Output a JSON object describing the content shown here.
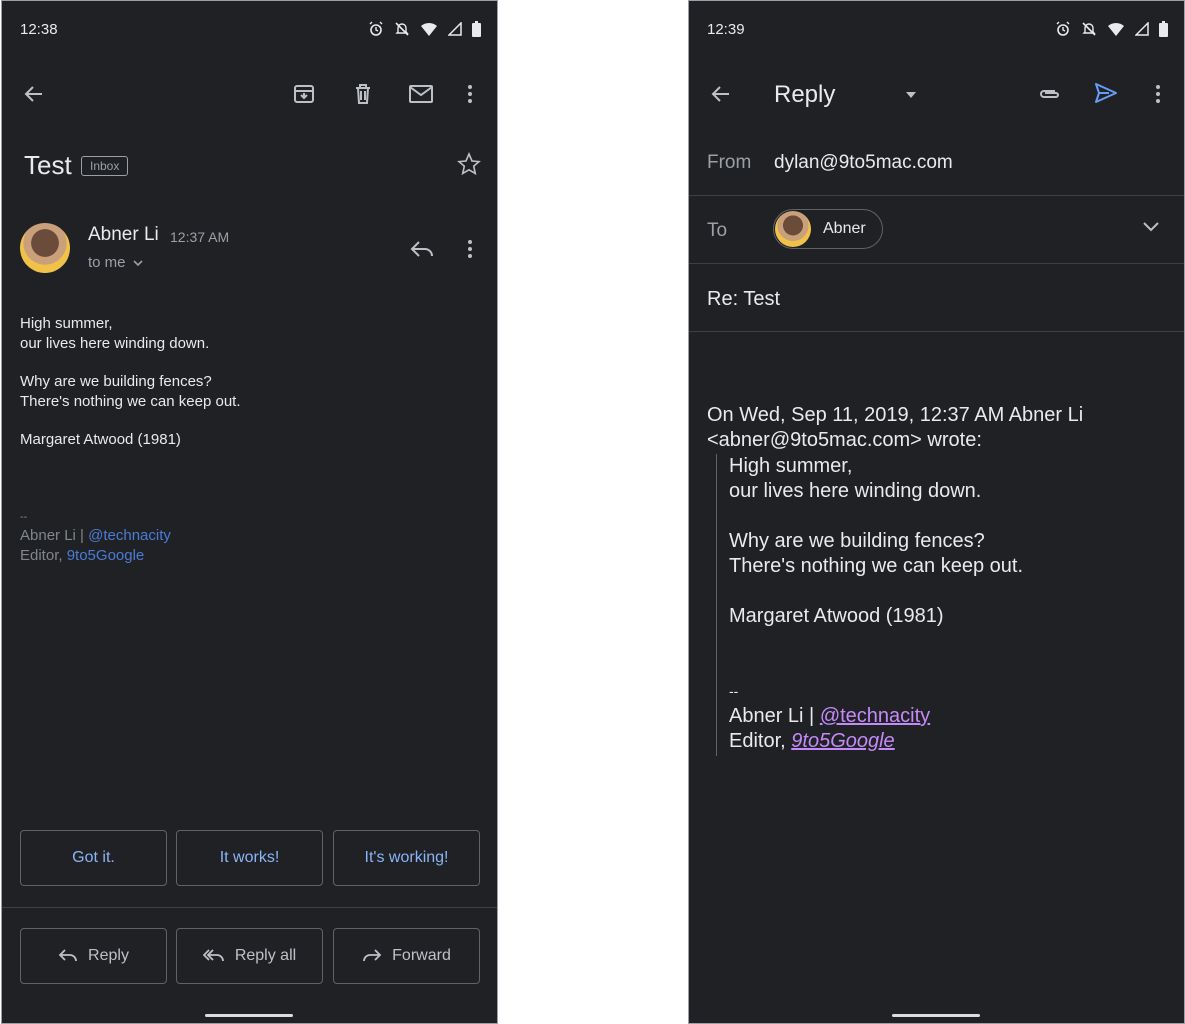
{
  "left": {
    "status_time": "12:38",
    "subject": "Test",
    "label_badge": "Inbox",
    "sender": "Abner Li",
    "sent_time": "12:37 AM",
    "recipient_line": "to me",
    "body_lines": [
      "High summer,",
      "our lives here winding down.",
      "Why are we building fences?",
      "There's nothing we can keep out.",
      "Margaret Atwood (1981)"
    ],
    "signature": {
      "dashes": "--",
      "name_prefix": "Abner Li | ",
      "handle": "@technacity",
      "role_prefix": "Editor, ",
      "site": "9to5Google"
    },
    "smart_replies": [
      "Got it.",
      "It works!",
      "It's working!"
    ],
    "actions": [
      "Reply",
      "Reply all",
      "Forward"
    ]
  },
  "right": {
    "status_time": "12:39",
    "compose_mode": "Reply",
    "from_label": "From",
    "from_value": "dylan@9to5mac.com",
    "to_label": "To",
    "to_chip": "Abner",
    "subject": "Re: Test",
    "quote_header_1": "On Wed, Sep 11, 2019, 12:37 AM Abner Li",
    "quote_header_2": "<abner@9to5mac.com> wrote:",
    "quoted_lines": [
      "High summer,",
      "our lives here winding down.",
      "Why are we building fences?",
      "There's nothing we can keep out.",
      "Margaret Atwood (1981)"
    ],
    "signature": {
      "dashes": "--",
      "name_prefix": "Abner Li | ",
      "handle": "@technacity",
      "role_prefix": "Editor, ",
      "site": "9to5Google"
    }
  },
  "colors": {
    "background": "#202124",
    "accent_blue": "#8ab4f8",
    "link_purple": "#c58af9",
    "send_blue": "#669df6"
  }
}
